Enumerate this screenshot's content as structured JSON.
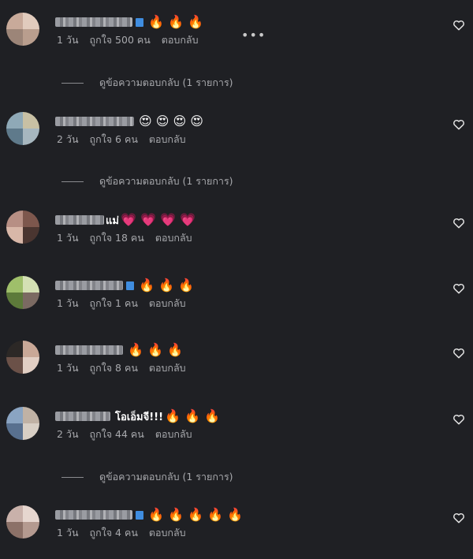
{
  "comments": [
    {
      "id": "c1",
      "username_width": 98,
      "verified": true,
      "message": "",
      "emoji": "🔥 🔥 🔥",
      "meta": {
        "time": "1 วัน",
        "likes": "ถูกใจ 500 คน",
        "reply": "ตอบกลับ"
      },
      "more": "•••",
      "replies_link": "ดูข้อความตอบกลับ (1 รายการ)",
      "avatar": [
        "#c8aa9a",
        "#e1cbbd",
        "#9c8578",
        "#b99e8e"
      ]
    },
    {
      "id": "c2",
      "username_width": 100,
      "verified": false,
      "message": "",
      "emoji": "😍 😍 😍 😍",
      "meta": {
        "time": "2 วัน",
        "likes": "ถูกใจ 6 คน",
        "reply": "ตอบกลับ"
      },
      "replies_link": "ดูข้อความตอบกลับ (1 รายการ)",
      "avatar": [
        "#8fa9b7",
        "#c8c0a4",
        "#5f7a8b",
        "#a7b7bf"
      ]
    },
    {
      "id": "c3",
      "username_width": 62,
      "verified": false,
      "message": "แม่",
      "emoji": "💗 💗 💗 💗",
      "meta": {
        "time": "1 วัน",
        "likes": "ถูกใจ 18 คน",
        "reply": "ตอบกลับ"
      },
      "avatar": [
        "#b78f84",
        "#7d574d",
        "#d8b7a8",
        "#4a3530"
      ]
    },
    {
      "id": "c4",
      "username_width": 86,
      "verified": true,
      "message": "",
      "emoji": "🔥 🔥 🔥",
      "meta": {
        "time": "1 วัน",
        "likes": "ถูกใจ 1 คน",
        "reply": "ตอบกลับ"
      },
      "avatar": [
        "#9fbf6a",
        "#5d7a3a",
        "#d4e0b4",
        "#7b6a62"
      ]
    },
    {
      "id": "c5",
      "username_width": 86,
      "verified": false,
      "message": "",
      "emoji": "🔥 🔥 🔥",
      "meta": {
        "time": "1 วัน",
        "likes": "ถูกใจ 8 คน",
        "reply": "ตอบกลับ"
      },
      "avatar": [
        "#2c2826",
        "#c9a897",
        "#6b5148",
        "#e2cfc4"
      ]
    },
    {
      "id": "c6",
      "username_width": 70,
      "verified": false,
      "message": "โอเอ็มจี!!!",
      "emoji": "🔥 🔥 🔥",
      "meta": {
        "time": "2 วัน",
        "likes": "ถูกใจ 44 คน",
        "reply": "ตอบกลับ"
      },
      "replies_link": "ดูข้อความตอบกลับ (1 รายการ)",
      "avatar": [
        "#8aa4c2",
        "#c0b2a5",
        "#58708f",
        "#d8cfc5"
      ]
    },
    {
      "id": "c7",
      "username_width": 98,
      "verified": true,
      "message": "",
      "emoji": "🔥 🔥 🔥 🔥 🔥",
      "meta": {
        "time": "1 วัน",
        "likes": "ถูกใจ 4 คน",
        "reply": "ตอบกลับ"
      },
      "avatar": [
        "#c9b1aa",
        "#e6d6cf",
        "#8c7168",
        "#b49a90"
      ]
    }
  ]
}
